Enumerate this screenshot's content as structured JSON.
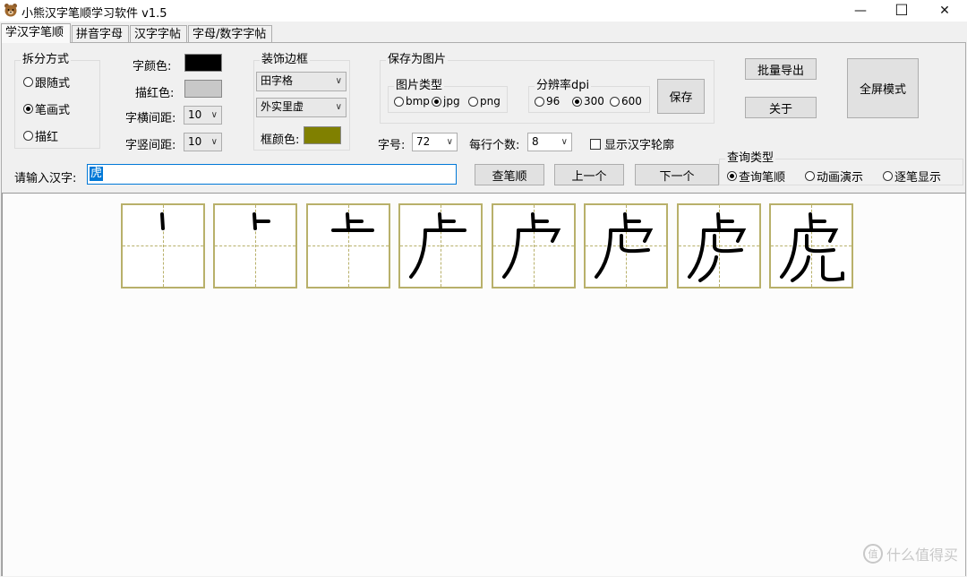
{
  "window": {
    "title": "小熊汉字笔顺学习软件 v1.5",
    "min_symbol": "—",
    "max_symbol": "☐",
    "close_symbol": "✕"
  },
  "tabs": [
    "学汉字笔顺",
    "拼音字母",
    "汉字字帖",
    "字母/数字字帖"
  ],
  "split_mode": {
    "title": "拆分方式",
    "options": [
      "跟随式",
      "笔画式",
      "描红"
    ],
    "selected": "笔画式"
  },
  "colors": {
    "char_color_label": "字颜色:",
    "char_color": "#000000",
    "trace_color_label": "描红色:",
    "trace_color": "#c8c8c8",
    "frame_color_label": "框颜色:",
    "frame_color": "#808000",
    "cell_border": "#b8b06a"
  },
  "spacing": {
    "h_label": "字横间距:",
    "h_value": "10",
    "v_label": "字竖间距:",
    "v_value": "10"
  },
  "border_group": {
    "title": "装饰边框",
    "grid_type": "田字格",
    "line_style": "外实里虚"
  },
  "save_group": {
    "title": "保存为图片",
    "type_title": "图片类型",
    "types": [
      "bmp",
      "jpg",
      "png"
    ],
    "type_selected": "jpg",
    "dpi_title": "分辨率dpi",
    "dpis": [
      "96",
      "300",
      "600"
    ],
    "dpi_selected": "300",
    "save_button": "保存"
  },
  "font_size": {
    "label": "字号:",
    "value": "72"
  },
  "per_row": {
    "label": "每行个数:",
    "value": "8"
  },
  "show_outline": {
    "label": "显示汉字轮廓",
    "checked": false
  },
  "buttons": {
    "batch_export": "批量导出",
    "about": "关于",
    "fullscreen": "全屏模式",
    "lookup": "查笔顺",
    "prev": "上一个",
    "next": "下一个"
  },
  "query_type": {
    "title": "查询类型",
    "options": [
      "查询笔顺",
      "动画演示",
      "逐笔显示"
    ],
    "selected": "查询笔顺"
  },
  "input": {
    "label": "请输入汉字:",
    "value": "虎"
  },
  "stroke_cells": [
    "stroke-1",
    "stroke-2",
    "stroke-3",
    "stroke-4",
    "stroke-5",
    "stroke-6",
    "stroke-7",
    "stroke-8"
  ],
  "watermark": "什么值得买"
}
